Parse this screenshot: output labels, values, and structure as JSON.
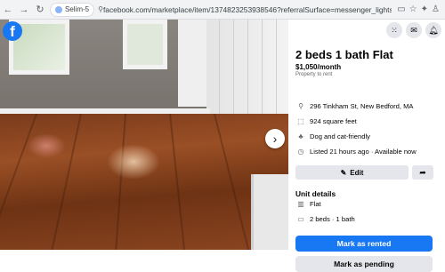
{
  "browser": {
    "back_icon": "arrow-left-icon",
    "forward_icon": "arrow-right-icon",
    "reload_icon": "reload-icon",
    "profile_label": "Selim-5",
    "url": "facebook.com/marketplace/item/1374823253938546?referralSurface=messenger_lightspeed_banner&referralCode=messeng..."
  },
  "photo": {
    "logo_letter": "f",
    "next_icon": "chevron-right-icon",
    "thumb_count": 8
  },
  "header": {
    "icons": [
      "menu-grid-icon",
      "messenger-icon",
      "bell-icon"
    ]
  },
  "listing": {
    "title": "2 beds 1 bath Flat",
    "price": "$1,050/month",
    "price_sub": "Property to rent",
    "address": "296 Tinkham St, New Bedford, MA",
    "size": "924 square feet",
    "pets": "Dog and cat-friendly",
    "listed": "Listed 21 hours ago · Available now",
    "edit_label": "Edit",
    "unit_details_title": "Unit details",
    "unit_type": "Flat",
    "beds_baths": "2 beds · 1 bath",
    "mark_rented_label": "Mark as rented",
    "mark_pending_label": "Mark as pending"
  },
  "colors": {
    "accent": "#1877f2",
    "button_gray": "#e4e6eb",
    "secondary_text": "#65676b"
  }
}
